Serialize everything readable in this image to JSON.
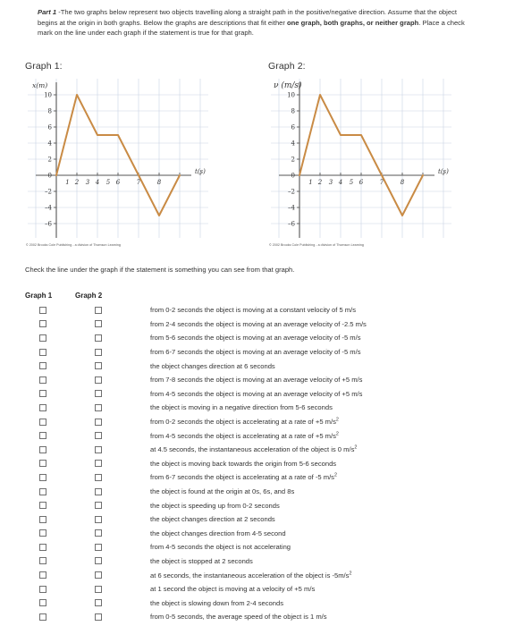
{
  "intro": {
    "label": "Part 1",
    "text_1": " -The two graphs below represent two objects travelling along a straight path in the positive/negative direction. Assume that the object begins at the origin in both graphs.  Below the graphs are descriptions that fit either ",
    "bold_1": "one graph, both graphs, or neither graph",
    "text_2": ".  Place a check mark on the line under each graph if the statement is true for that graph."
  },
  "graph1": {
    "title": "Graph 1:",
    "ylabel": "x(m)",
    "xlabel": "t(s)",
    "copyright": "© 2002 Brooks Cole Publishing - a division of Thomson Learning"
  },
  "graph2": {
    "title": "Graph 2:",
    "ylabel": "ν (m/s)",
    "xlabel": "t(s)",
    "copyright": "© 2002 Brooks Cole Publishing - a division of Thomson Learning"
  },
  "check_note": "Check the line under the graph if the statement is something you can see from that graph.",
  "columns": {
    "graph1_head": "Graph 1",
    "graph2_head": "Graph 2"
  },
  "statements": [
    "from 0-2 seconds the object is moving at a constant velocity of 5 m/s",
    "from 2-4 seconds the object is moving at an average velocity of -2.5 m/s",
    "from 5-6 seconds the object is moving at an average velocity of -5 m/s",
    "from 6-7 seconds the object is moving at an average velocity of -5 m/s",
    "the object changes direction at 6 seconds",
    "from 7-8 seconds the object is moving at an average velocity of +5 m/s",
    "from 4-5 seconds the object is moving at an average velocity of +5 m/s",
    "the object is moving in a negative direction from 5-6 seconds",
    "from 0-2 seconds the object is accelerating at a rate of +5 m/s²",
    "from 4-5 seconds the object is accelerating at a rate of +5 m/s²",
    "at 4.5 seconds, the instantaneous acceleration of the object is 0 m/s²",
    "the object is moving back towards the origin from 5-6 seconds",
    "from 6-7 seconds the object is accelerating at a rate of -5 m/s²",
    "the object is found at the origin at 0s, 6s, and 8s",
    "the object is speeding up from 0-2 seconds",
    "the object changes direction at 2 seconds",
    "the object changes direction from 4-5 second",
    "from 4-5 seconds the object is not accelerating",
    "the object is stopped at 2 seconds",
    "at 6 seconds, the instantaneous acceleration of the object is -5m/s²",
    "at 1 second the object is moving at a velocity of +5 m/s",
    "the object is slowing down from 2-4 seconds",
    "from 0-5 seconds, the average speed of the object is 1 m/s"
  ],
  "chart_data": [
    {
      "type": "line",
      "title": "Graph 1",
      "xlabel": "t(s)",
      "ylabel": "x(m)",
      "xlim": [
        0,
        8.6
      ],
      "ylim": [
        -6,
        11
      ],
      "xticks": [
        1,
        2,
        3,
        4,
        5,
        6,
        7,
        8
      ],
      "yticks": [
        10,
        8,
        6,
        4,
        2,
        0,
        -2,
        -4,
        -6
      ],
      "grid": true,
      "legend": "none",
      "line_color": "#c98b45",
      "points": [
        {
          "x": 0,
          "y": 0
        },
        {
          "x": 2,
          "y": 10
        },
        {
          "x": 4,
          "y": 5
        },
        {
          "x": 5,
          "y": 5
        },
        {
          "x": 7,
          "y": -5
        },
        {
          "x": 8,
          "y": 0
        }
      ]
    },
    {
      "type": "line",
      "title": "Graph 2",
      "xlabel": "t(s)",
      "ylabel": "v (m/s)",
      "xlim": [
        0,
        8.6
      ],
      "ylim": [
        -6,
        11
      ],
      "xticks": [
        1,
        2,
        3,
        4,
        5,
        6,
        7,
        8
      ],
      "yticks": [
        10,
        8,
        6,
        4,
        2,
        0,
        -2,
        -4,
        -6
      ],
      "grid": true,
      "legend": "none",
      "line_color": "#c98b45",
      "points": [
        {
          "x": 0,
          "y": 0
        },
        {
          "x": 2,
          "y": 10
        },
        {
          "x": 4,
          "y": 5
        },
        {
          "x": 5,
          "y": 5
        },
        {
          "x": 7,
          "y": -5
        },
        {
          "x": 8,
          "y": 0
        }
      ]
    }
  ],
  "colors": {
    "line": "#c98b45",
    "grid": "#c9d4e4",
    "axis": "#555555",
    "text": "#333333"
  }
}
